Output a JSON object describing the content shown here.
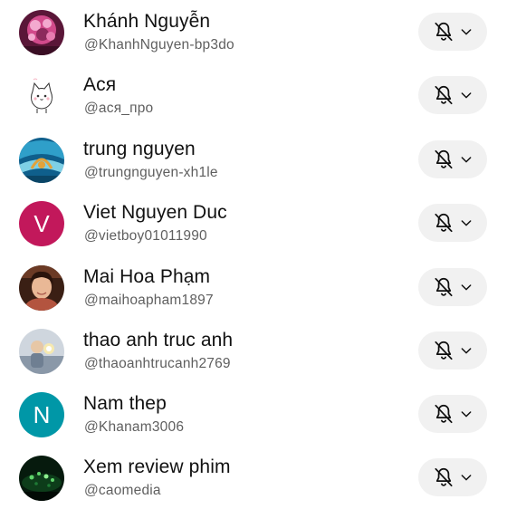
{
  "subscriptions": [
    {
      "name": "Khánh Nguyễn",
      "handle": "@KhanhNguyen-bp3do",
      "avatar": {
        "kind": "photo",
        "palette": [
          "#5a1638",
          "#d14a8b",
          "#f3a9cf",
          "#8c2a5c"
        ]
      }
    },
    {
      "name": "Ася",
      "handle": "@ася_про",
      "avatar": {
        "kind": "cartoon-cat",
        "palette": [
          "#ffffff",
          "#333333",
          "#f6b6c4"
        ]
      }
    },
    {
      "name": "trung nguyen",
      "handle": "@trungnguyen-xh1le",
      "avatar": {
        "kind": "photo",
        "palette": [
          "#0f5f8c",
          "#2f9fc9",
          "#e2a23a",
          "#7ed0e6"
        ]
      }
    },
    {
      "name": "Viet Nguyen Duc",
      "handle": "@vietboy01011990",
      "avatar": {
        "kind": "letter",
        "letter": "V",
        "color": "#c2185b"
      }
    },
    {
      "name": "Mai Hoa Phạm",
      "handle": "@maihoapham1897",
      "avatar": {
        "kind": "photo",
        "palette": [
          "#3a1f14",
          "#e9b896",
          "#f3d6c0",
          "#b3543f"
        ]
      }
    },
    {
      "name": "thao anh truc anh",
      "handle": "@thaoanhtrucanh2769",
      "avatar": {
        "kind": "photo",
        "palette": [
          "#cfd6de",
          "#8a98a8",
          "#e7c7a6",
          "#f6e9b0"
        ]
      }
    },
    {
      "name": "Nam thep",
      "handle": "@Khanam3006",
      "avatar": {
        "kind": "letter",
        "letter": "N",
        "color": "#0097a7"
      }
    },
    {
      "name": "Xem review phim",
      "handle": "@caomedia",
      "avatar": {
        "kind": "photo",
        "palette": [
          "#061a0d",
          "#1e7a35",
          "#5fd46b",
          "#0d3d1a"
        ]
      }
    }
  ],
  "icons": {
    "notification": "bell-off-icon",
    "dropdown": "chevron-down-icon"
  }
}
